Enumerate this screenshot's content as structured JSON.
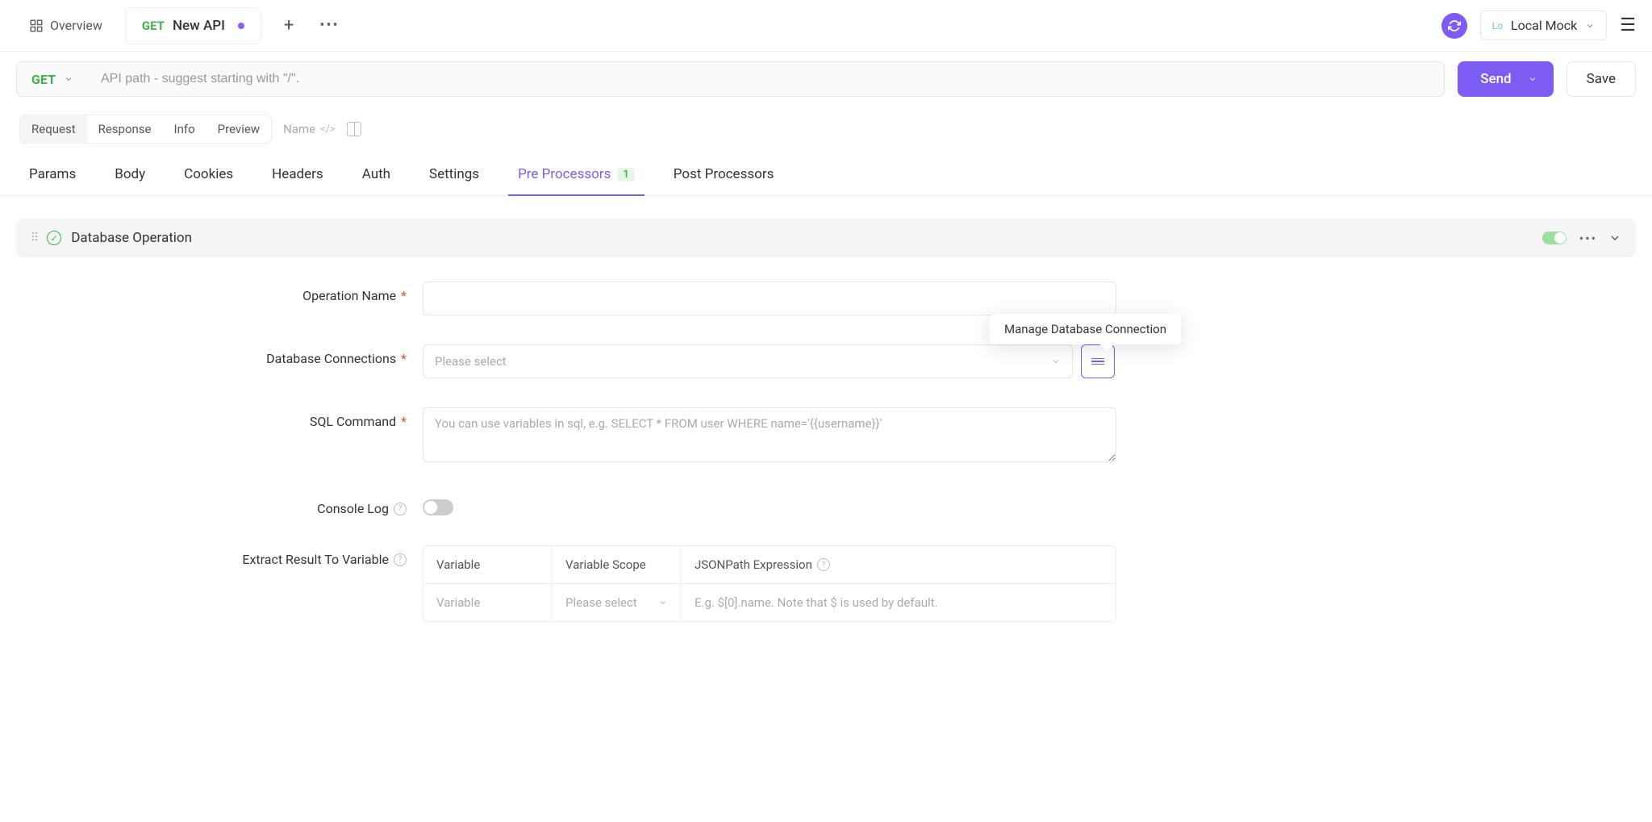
{
  "topbar": {
    "overview": "Overview",
    "tab_method": "GET",
    "tab_title": "New API",
    "env_prefix": "Lo",
    "env_name": "Local Mock"
  },
  "urlbar": {
    "method": "GET",
    "placeholder": "API path - suggest starting with \"/\".",
    "send": "Send",
    "save": "Save"
  },
  "viewtabs": {
    "request": "Request",
    "response": "Response",
    "info": "Info",
    "preview": "Preview",
    "name": "Name"
  },
  "subtabs": {
    "params": "Params",
    "body": "Body",
    "cookies": "Cookies",
    "headers": "Headers",
    "auth": "Auth",
    "settings": "Settings",
    "pre": "Pre Processors",
    "pre_count": "1",
    "post": "Post Processors"
  },
  "panel": {
    "title": "Database Operation",
    "tooltip": "Manage Database Connection",
    "op_name_label": "Operation Name",
    "db_conn_label": "Database Connections",
    "db_conn_ph": "Please select",
    "sql_label": "SQL Command",
    "sql_ph": "You can use variables in sql, e.g. SELECT * FROM user WHERE name='{{username}}'",
    "console_label": "Console Log",
    "extract_label": "Extract Result To Variable",
    "table": {
      "h1": "Variable",
      "h2": "Variable Scope",
      "h3": "JSONPath Expression",
      "r1c1": "Variable",
      "r1c2": "Please select",
      "r1c3": "E.g. $[0].name. Note that $ is used by default."
    }
  }
}
